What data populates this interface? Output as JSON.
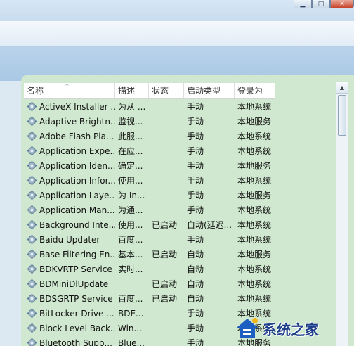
{
  "window": {
    "minimize_glyph": "▁",
    "maximize_glyph": "□",
    "close_glyph": "✕"
  },
  "columns": [
    {
      "key": "name",
      "label": "名称"
    },
    {
      "key": "desc",
      "label": "描述"
    },
    {
      "key": "status",
      "label": "状态"
    },
    {
      "key": "startup",
      "label": "启动类型"
    },
    {
      "key": "logon",
      "label": "登录为"
    }
  ],
  "sort_indicator": "^",
  "services": [
    {
      "name": "ActiveX Installer ...",
      "desc": "为从 ...",
      "status": "",
      "startup": "手动",
      "logon": "本地系统"
    },
    {
      "name": "Adaptive Brightn...",
      "desc": "监视...",
      "status": "",
      "startup": "手动",
      "logon": "本地服务"
    },
    {
      "name": "Adobe Flash Pla...",
      "desc": "此服...",
      "status": "",
      "startup": "手动",
      "logon": "本地系统"
    },
    {
      "name": "Application Expe...",
      "desc": "在应...",
      "status": "",
      "startup": "手动",
      "logon": "本地系统"
    },
    {
      "name": "Application Iden...",
      "desc": "确定...",
      "status": "",
      "startup": "手动",
      "logon": "本地服务"
    },
    {
      "name": "Application Infor...",
      "desc": "使用...",
      "status": "",
      "startup": "手动",
      "logon": "本地系统"
    },
    {
      "name": "Application Laye...",
      "desc": "为 In...",
      "status": "",
      "startup": "手动",
      "logon": "本地服务"
    },
    {
      "name": "Application Man...",
      "desc": "为通...",
      "status": "",
      "startup": "手动",
      "logon": "本地系统"
    },
    {
      "name": "Background Inte...",
      "desc": "使用...",
      "status": "已启动",
      "startup": "自动(延迟...",
      "logon": "本地系统"
    },
    {
      "name": "Baidu Updater",
      "desc": "百度...",
      "status": "",
      "startup": "手动",
      "logon": "本地系统"
    },
    {
      "name": "Base Filtering En...",
      "desc": "基本...",
      "status": "已启动",
      "startup": "自动",
      "logon": "本地服务"
    },
    {
      "name": "BDKVRTP Service",
      "desc": "实时...",
      "status": "",
      "startup": "自动",
      "logon": "本地系统"
    },
    {
      "name": "BDMiniDlUpdate",
      "desc": "",
      "status": "已启动",
      "startup": "自动",
      "logon": "本地系统"
    },
    {
      "name": "BDSGRTP Service",
      "desc": "百度...",
      "status": "已启动",
      "startup": "自动",
      "logon": "本地系统"
    },
    {
      "name": "BitLocker Drive ...",
      "desc": "BDE...",
      "status": "",
      "startup": "手动",
      "logon": "本地系统"
    },
    {
      "name": "Block Level Back...",
      "desc": "Win...",
      "status": "",
      "startup": "手动",
      "logon": "本地系统"
    },
    {
      "name": "Bluetooth Supp...",
      "desc": "Blue...",
      "status": "",
      "startup": "手动",
      "logon": "本地服务"
    }
  ],
  "scrollbar": {
    "up_glyph": "▲"
  },
  "watermark": {
    "text": "系统之家"
  },
  "colors": {
    "pane_bg": "#cfe8cf",
    "header_bg": "#ffffff"
  }
}
